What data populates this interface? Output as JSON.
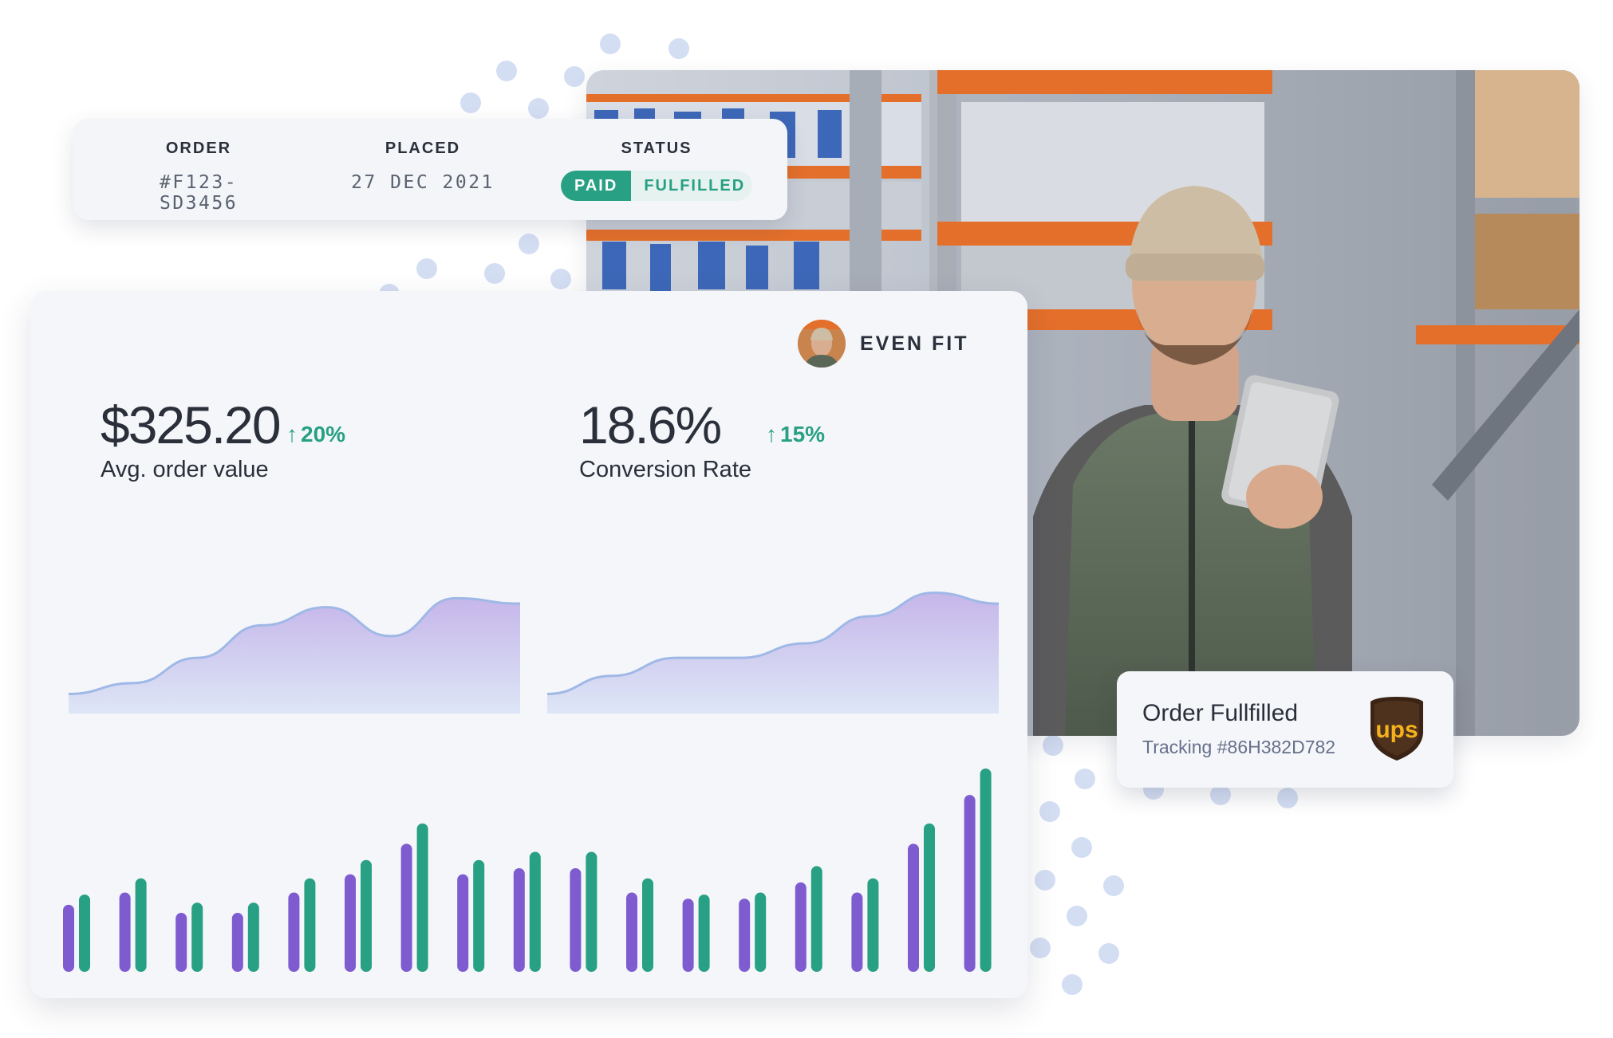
{
  "order_card": {
    "order_label": "ORDER",
    "order_value": "#F123-SD3456",
    "placed_label": "PLACED",
    "placed_value": "27 DEC 2021",
    "status_label": "STATUS",
    "status_paid": "PAID",
    "status_fulfilled": "FULFILLED"
  },
  "dashboard": {
    "brand_name": "EVEN FIT",
    "metrics": [
      {
        "value": "$325.20",
        "delta": "20%",
        "label": "Avg. order value"
      },
      {
        "value": "18.6%",
        "delta": "15%",
        "label": "Conversion Rate"
      }
    ]
  },
  "fulfilled_card": {
    "title": "Order Fullfilled",
    "tracking": "Tracking #86H382D782",
    "carrier_logo_text": "ups"
  },
  "colors": {
    "accent_green": "#27a083",
    "accent_purple": "#7e5cd0",
    "text_dark": "#2a2f3a",
    "dot_blue": "#d4def3"
  },
  "chart_data": [
    {
      "type": "area",
      "series": [
        {
          "values": [
            2,
            8,
            22,
            40,
            50,
            34,
            55,
            52
          ]
        }
      ]
    },
    {
      "type": "area",
      "series": [
        {
          "values": [
            2,
            12,
            22,
            22,
            30,
            45,
            58,
            52
          ]
        }
      ]
    },
    {
      "type": "bar",
      "series": [
        {
          "values": [
            33,
            39,
            29,
            29,
            39,
            48,
            63,
            48,
            51,
            51,
            39,
            36,
            36,
            44,
            39,
            63,
            87
          ]
        },
        {
          "values": [
            38,
            46,
            34,
            34,
            46,
            55,
            73,
            55,
            59,
            59,
            46,
            38,
            39,
            52,
            46,
            73,
            100
          ]
        }
      ]
    }
  ]
}
